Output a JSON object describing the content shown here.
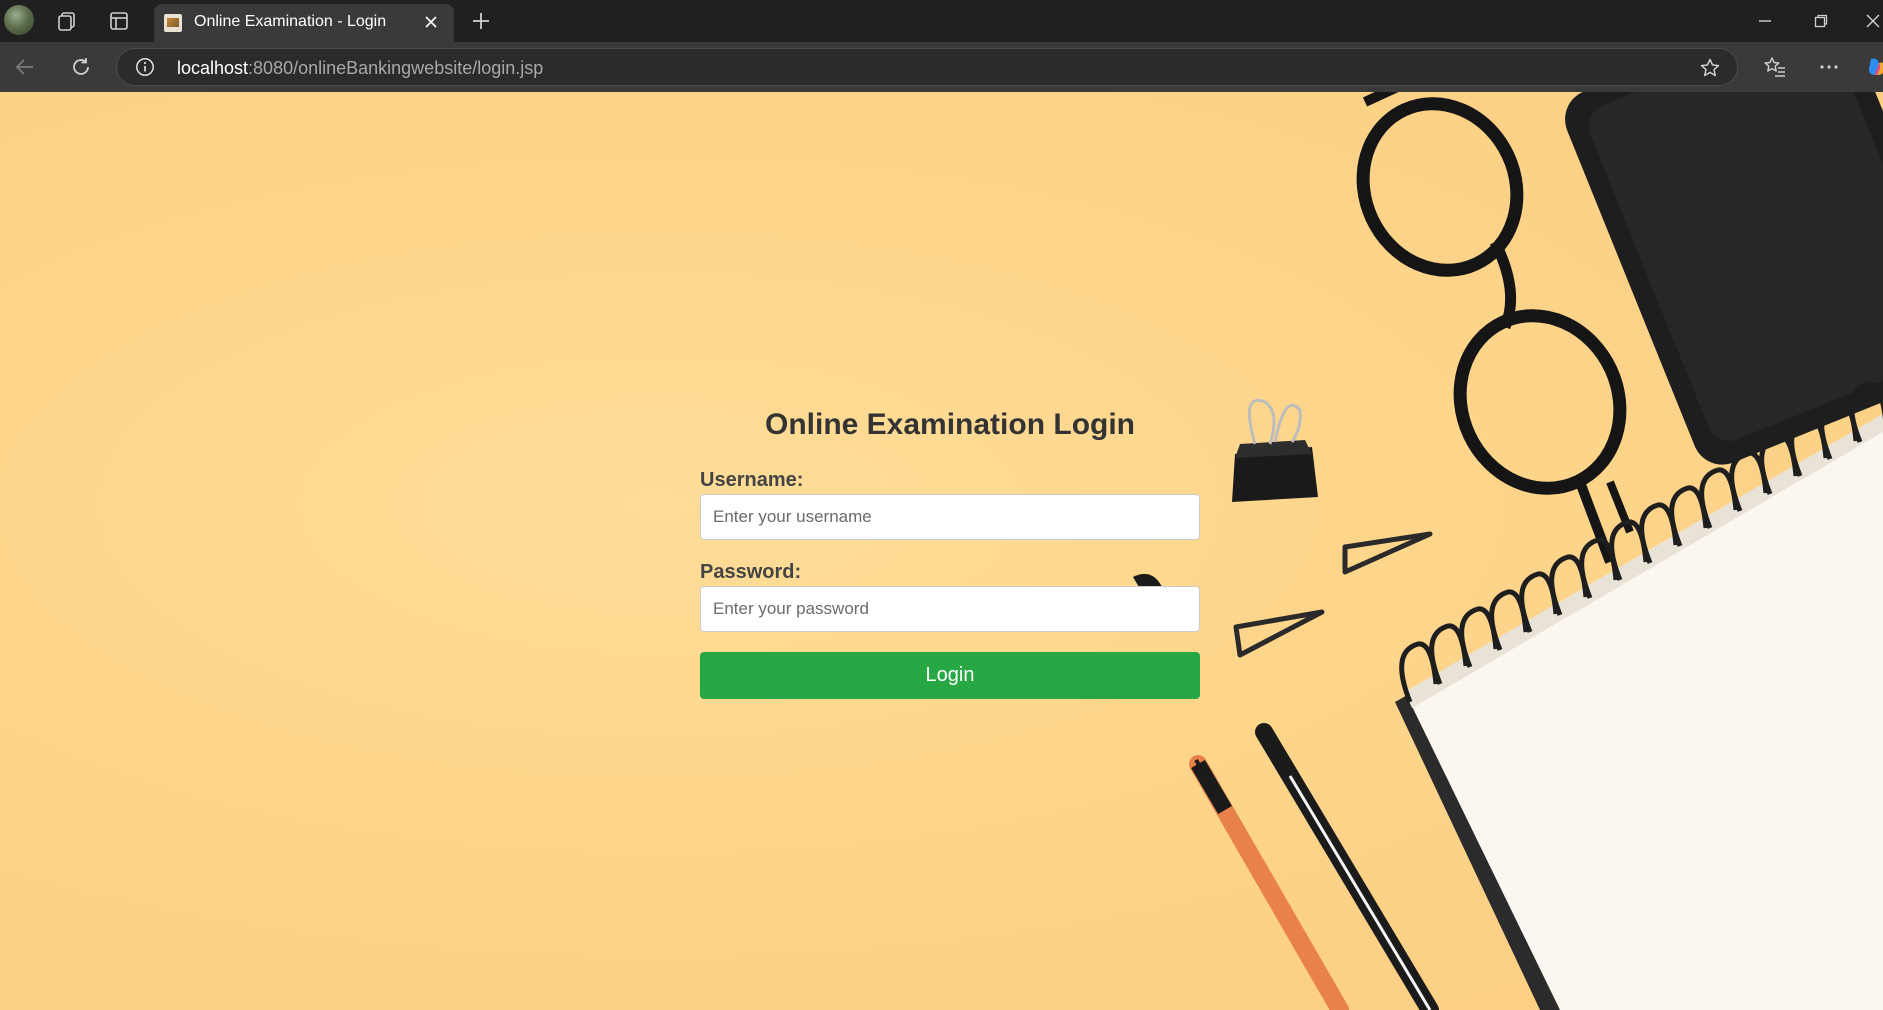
{
  "browser": {
    "tab": {
      "title": "Online Examination - Login"
    },
    "url": {
      "host": "localhost",
      "path": ":8080/onlineBankingwebsite/login.jsp"
    }
  },
  "icons": {
    "profile": "profile-avatar",
    "workspaces": "workspaces-icon",
    "tab_actions": "tab-actions-icon",
    "close_tab": "close-icon",
    "new_tab": "plus-icon",
    "minimize": "minimize-icon",
    "restore": "restore-icon",
    "close_window": "close-icon",
    "back": "back-arrow-icon",
    "refresh": "refresh-icon",
    "site_info": "info-icon",
    "favorite": "star-icon",
    "favorites": "favorites-icon",
    "more": "more-icon",
    "copilot": "copilot-icon"
  },
  "login": {
    "title": "Online Examination Login",
    "username_label": "Username:",
    "username_placeholder": "Enter your username",
    "username_value": "",
    "password_label": "Password:",
    "password_placeholder": "Enter your password",
    "password_value": "",
    "button_label": "Login"
  },
  "colors": {
    "page_background": "#fdd68c",
    "login_button": "#28a745",
    "title_text": "#333333",
    "browser_chrome": "#202020"
  }
}
